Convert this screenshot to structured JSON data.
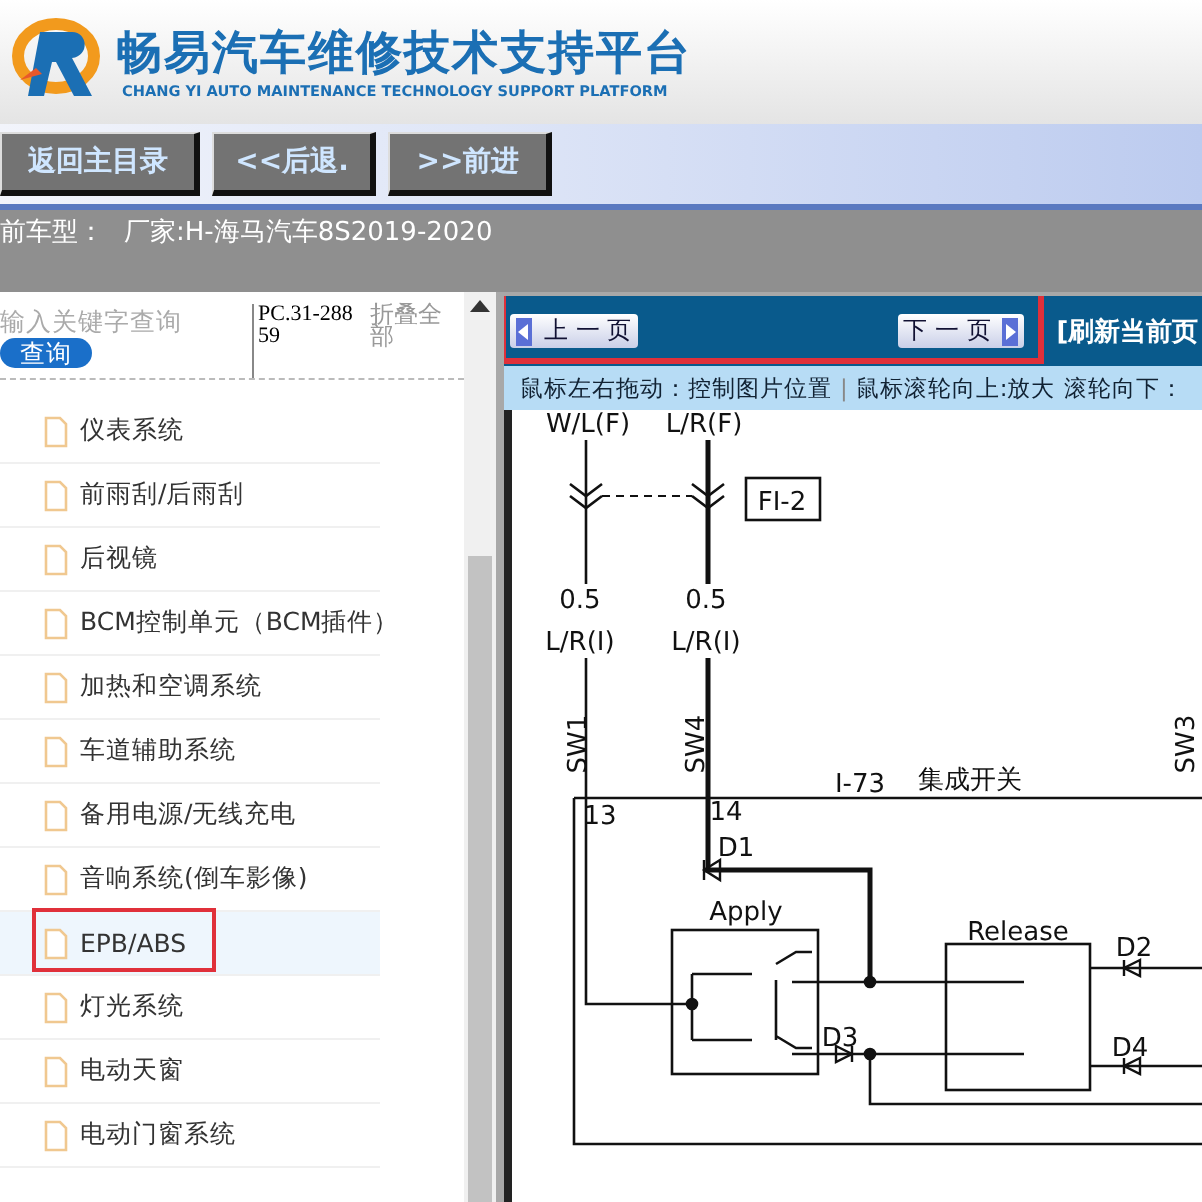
{
  "header": {
    "title": "畅易汽车维修技术支持平台",
    "subtitle": "CHANG YI AUTO MAINTENANCE TECHNOLOGY SUPPORT PLATFORM"
  },
  "nav_buttons": [
    "返回主目录",
    "<<后退.",
    ">>前进"
  ],
  "vehicle_info": {
    "label": "前车型：",
    "value": "厂家:H-海马汽车8S2019-2020"
  },
  "sidebar": {
    "search": {
      "placeholder": "输入关键字查询",
      "button": "查询"
    },
    "code": "PC.31-28859",
    "collapse_all": "折叠全部",
    "items": [
      {
        "label": "仪表系统",
        "selected": false,
        "highlighted": false
      },
      {
        "label": "前雨刮/后雨刮",
        "selected": false,
        "highlighted": false
      },
      {
        "label": "后视镜",
        "selected": false,
        "highlighted": false
      },
      {
        "label": "BCM控制单元（BCM插件）",
        "selected": false,
        "highlighted": false
      },
      {
        "label": "加热和空调系统",
        "selected": false,
        "highlighted": false
      },
      {
        "label": "车道辅助系统",
        "selected": false,
        "highlighted": false
      },
      {
        "label": "备用电源/无线充电",
        "selected": false,
        "highlighted": false
      },
      {
        "label": "音响系统(倒车影像)",
        "selected": false,
        "highlighted": false
      },
      {
        "label": "EPB/ABS",
        "selected": true,
        "highlighted": true
      },
      {
        "label": "灯光系统",
        "selected": false,
        "highlighted": false
      },
      {
        "label": "电动天窗",
        "selected": false,
        "highlighted": false
      },
      {
        "label": "电动门窗系统",
        "selected": false,
        "highlighted": false
      }
    ]
  },
  "viewer": {
    "prev": "上 一 页",
    "next": "下 一 页",
    "refresh": "[刷新当前页",
    "pager_highlighted": true,
    "hint": [
      "鼠标左右拖动：控制图片位置",
      "|",
      "鼠标滚轮向上:放大",
      "滚轮向下："
    ],
    "diagram_labels": [
      "W/L(F)",
      "L/R(F)",
      "FI-2",
      "0.5",
      "L/R(I)",
      "0.5",
      "L/R(I)",
      "SW1",
      "SW4",
      "SW3",
      "I-73",
      "集成开关",
      "13",
      "14",
      "D1",
      "Apply",
      "Release",
      "D2",
      "D3",
      "D4"
    ]
  }
}
